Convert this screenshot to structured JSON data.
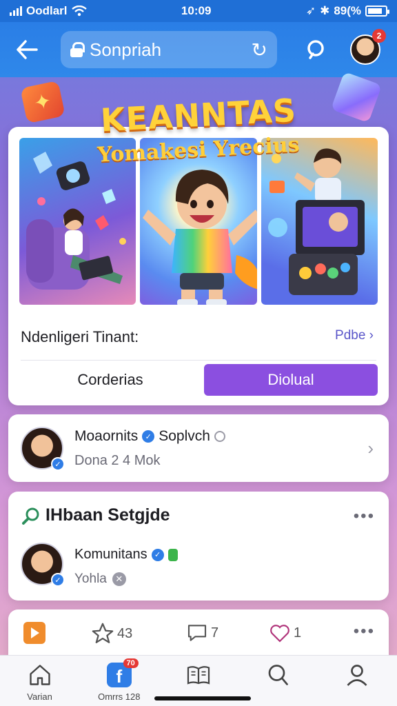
{
  "status_bar": {
    "carrier": "Oodlarl",
    "time": "10:09",
    "battery": "89(%"
  },
  "header": {
    "url": "Sonpriah"
  },
  "hero": {
    "title": "KEANNTAS",
    "subtitle": "Yomakesi Yrecius"
  },
  "feature": {
    "title": "Ndenligeri Tinant:",
    "more_label": "Pdbe ›",
    "secondary_button": "Corderias",
    "primary_button": "Diolual"
  },
  "profile": {
    "name": "Moaornits",
    "name_suffix": "Soplvch",
    "subtitle": "Dona 2 4 Mok"
  },
  "group": {
    "title": "IHbaan Setgjde",
    "member_name": "Komunitans",
    "member_sub": "Yohla"
  },
  "actions": {
    "star_count": "43",
    "comment_count": "7",
    "heart_count": "1"
  },
  "bottom_nav": {
    "items": [
      {
        "label": "Varian",
        "icon": "home-icon"
      },
      {
        "label": "Omrrs 128",
        "icon": "facebook-icon",
        "badge": "70"
      },
      {
        "label": "",
        "icon": "book-icon"
      },
      {
        "label": "",
        "icon": "search-icon"
      },
      {
        "label": "",
        "icon": "profile-icon"
      }
    ]
  },
  "colors": {
    "header_blue": "#2a7ee6",
    "primary_purple": "#8b4fe0",
    "badge_red": "#e53935"
  }
}
